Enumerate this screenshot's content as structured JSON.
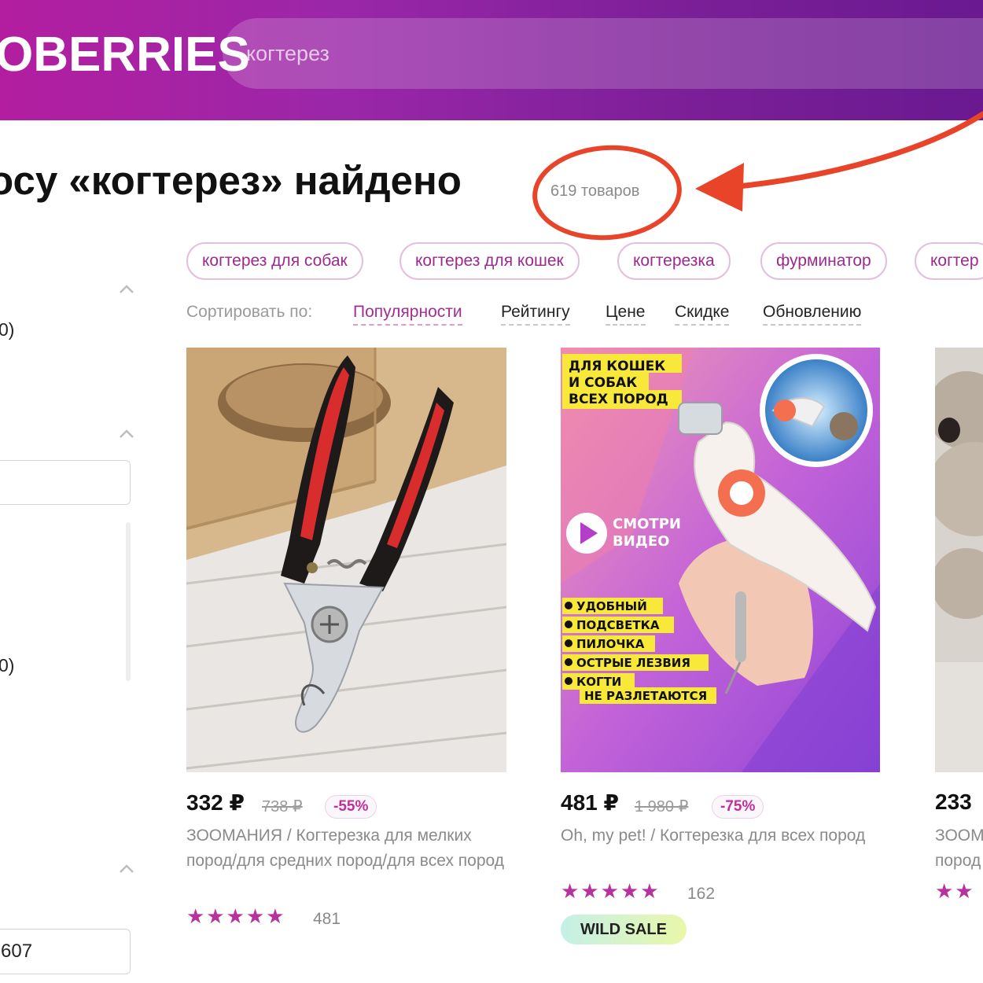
{
  "header": {
    "logo_text": "OBERRIES",
    "search_value": "когтерез"
  },
  "results": {
    "title": "осу «когтерез» найдено",
    "count": "619 товаров"
  },
  "chips": [
    "когтерез для собак",
    "когтерез для кошек",
    "когтерезка",
    "фурминатор",
    "когтер"
  ],
  "sort": {
    "label": "Сортировать по:",
    "options": [
      "Популярности",
      "Рейтингу",
      "Цене",
      "Скидке",
      "Обновлению"
    ],
    "active": "Популярности"
  },
  "sidebar": {
    "text1": "0)",
    "text2": "0)",
    "input_value": "607"
  },
  "products": [
    {
      "price": "332 ₽",
      "old_price": "738 ₽",
      "discount": "-55%",
      "name": "ЗООМАНИЯ / Когтерезка для мелких пород/для средних пород/для всех пород",
      "stars": "★★★★★",
      "reviews": "481"
    },
    {
      "price": "481 ₽",
      "old_price": "1 980 ₽",
      "discount": "-75%",
      "name": "Oh, my pet! / Когтерезка для всех пород",
      "stars": "★★★★★",
      "reviews": "162",
      "badge": "WILD SALE",
      "promo": {
        "headline": [
          "ДЛЯ КОШЕК",
          "И СОБАК",
          "ВСЕХ ПОРОД"
        ],
        "video": [
          "СМОТРИ",
          "ВИДЕО"
        ],
        "features": [
          "УДОБНЫЙ",
          "ПОДСВЕТКА",
          "ПИЛОЧКА",
          "ОСТРЫЕ ЛЕЗВИЯ",
          "КОГТИ",
          "НЕ РАЗЛЕТАЮТСЯ"
        ]
      }
    },
    {
      "price": "233",
      "name": "ЗООМ пород",
      "stars": "★★"
    }
  ],
  "colors": {
    "brand": "#9a27a8",
    "accent": "#b8329f",
    "annotation": "#e8442a"
  }
}
